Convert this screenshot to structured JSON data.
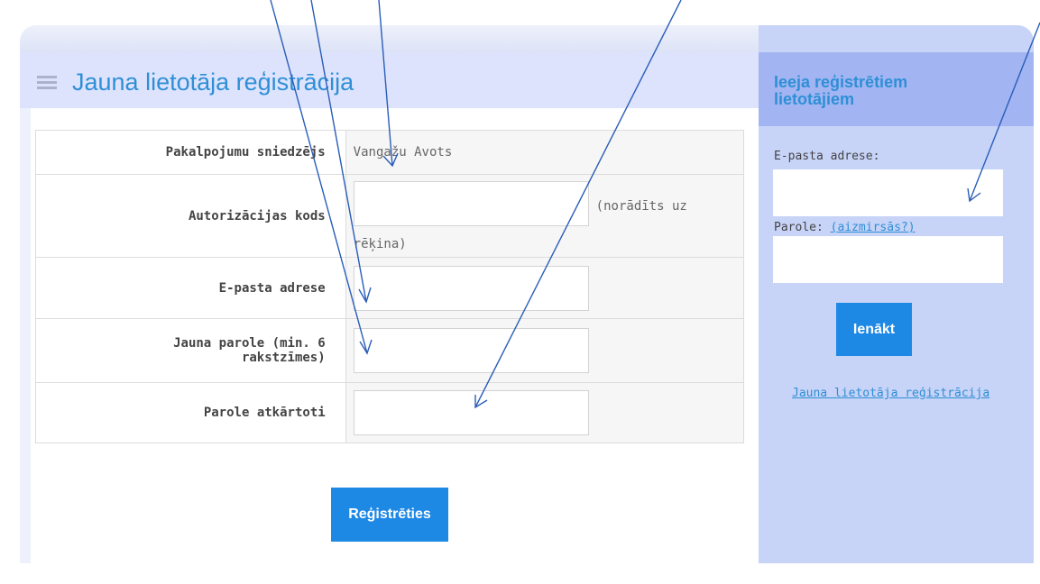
{
  "main": {
    "title": "Jauna lietotāja reģistrācija",
    "rows": [
      {
        "label": "Pakalpojumu sniedzējs",
        "value": "Vangažu Avots"
      },
      {
        "label": "Autorizācijas kods",
        "hint": "(norādīts uz",
        "hint_cont": "rēķina)"
      },
      {
        "label": "E-pasta adrese"
      },
      {
        "label": "Jauna parole (min. 6",
        "label_cont": "rakstzīmes)"
      },
      {
        "label": "Parole atkārtoti"
      }
    ],
    "register_button": "Reģistrēties"
  },
  "sidebar": {
    "title": "Ieeja reģistrētiem lietotājiem",
    "email_label": "E-pasta adrese:",
    "password_label": "Parole:",
    "forgot_link": "(aizmirsās?)",
    "login_button": "Ienākt",
    "register_link": "Jauna lietotāja reģistrācija"
  },
  "colors": {
    "accent": "#2f8fd6",
    "button": "#1e88e5",
    "sidebar_bg": "#c7d3f7",
    "header_bg": "#dde3fd",
    "arrow": "#2a5db8"
  },
  "icons": [
    "menu-icon"
  ]
}
